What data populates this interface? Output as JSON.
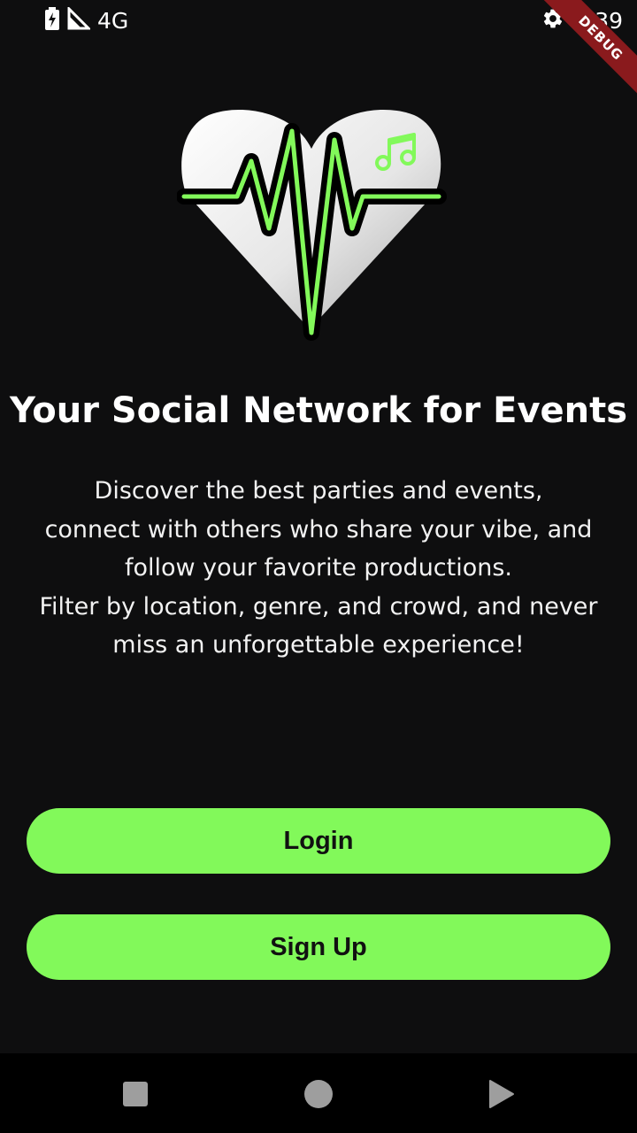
{
  "status_bar": {
    "network": "4G",
    "time": "9:39",
    "icons": [
      "battery-icon",
      "signal-icon",
      "settings-icon"
    ]
  },
  "debug_banner": "DEBUG",
  "logo": {
    "icon": "heart-pulse-music-icon",
    "colors": {
      "heart": "#e8e8e8",
      "pulse": "#82f95a",
      "outline": "#000000"
    }
  },
  "onboarding": {
    "title": "Your Social Network for Events",
    "description_lines": [
      "Discover the best parties and events,",
      "connect with others who share your vibe, and",
      "follow your favorite productions.",
      "Filter by location, genre, and crowd, and never",
      "miss an unforgettable experience!"
    ]
  },
  "actions": {
    "login_label": "Login",
    "signup_label": "Sign Up",
    "accent_color": "#82f95a"
  },
  "nav_bar": {
    "items": [
      "square-recents-icon",
      "circle-home-icon",
      "triangle-back-icon"
    ]
  }
}
